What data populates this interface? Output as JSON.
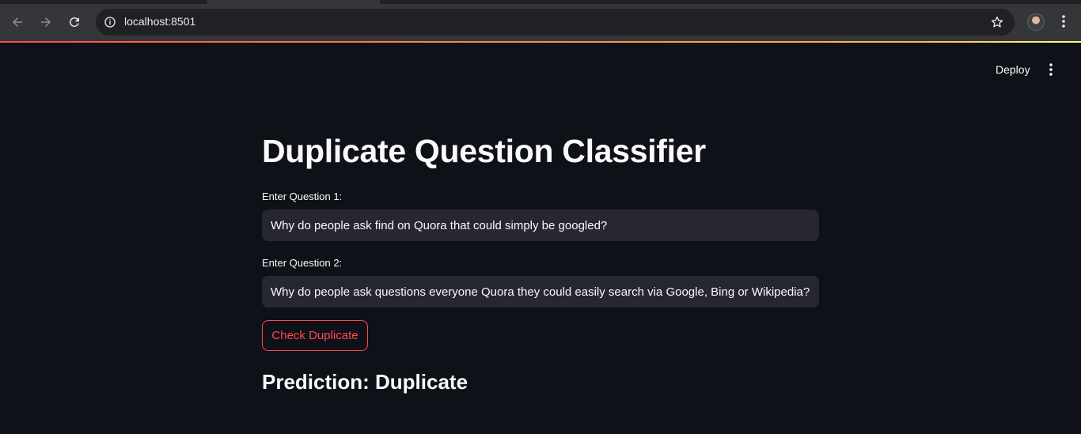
{
  "browser": {
    "url": "localhost:8501",
    "icons": {
      "back": "arrow-left-icon",
      "forward": "arrow-right-icon",
      "reload": "reload-icon",
      "site_info": "info-icon",
      "bookmark": "star-icon",
      "profile": "avatar",
      "menu": "kebab-menu-icon"
    }
  },
  "app_header": {
    "deploy_label": "Deploy",
    "menu_icon": "kebab-menu-icon"
  },
  "main": {
    "title": "Duplicate Question Classifier",
    "question1": {
      "label": "Enter Question 1:",
      "value": "Why do people ask find on Quora that could simply be googled?"
    },
    "question2": {
      "label": "Enter Question 2:",
      "value": "Why do people ask questions everyone Quora they could easily search via Google, Bing or Wikipedia?"
    },
    "check_button_label": "Check Duplicate",
    "prediction": "Prediction: Duplicate"
  },
  "colors": {
    "background": "#0e1117",
    "input_bg": "#262730",
    "accent": "#ff4b4b",
    "text": "#fafafa"
  }
}
